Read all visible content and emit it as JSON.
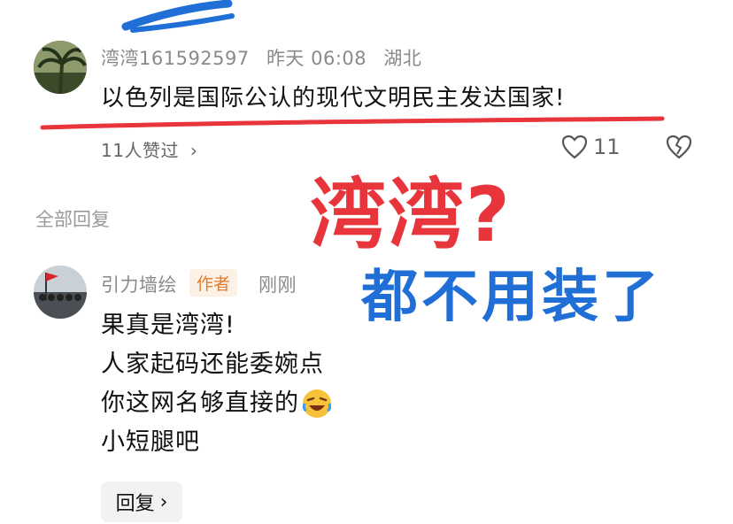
{
  "comment1": {
    "username": "湾湾161592597",
    "time": "昨天 06:08",
    "location": "湖北",
    "text": "以色列是国际公认的现代文明民主发达国家!",
    "likes_summary": "11人赞过",
    "like_count": "11"
  },
  "section": {
    "label": "全部回复"
  },
  "overlay": {
    "title": "湾湾?",
    "caption": "都不用装了"
  },
  "reply": {
    "username": "引力墙绘",
    "badge": "作者",
    "time": "刚刚",
    "lines": [
      "果真是湾湾!",
      "人家起码还能委婉点",
      "你这网名够直接的",
      "小短腿吧"
    ],
    "button_label": "回复"
  },
  "colors": {
    "accent_red": "#e8353b",
    "accent_blue": "#1f6fd6",
    "badge_orange": "#e07b2f"
  },
  "icons": [
    "heart-icon",
    "broken-heart-icon",
    "chevron-right-icon",
    "laughing-emoji-icon"
  ]
}
